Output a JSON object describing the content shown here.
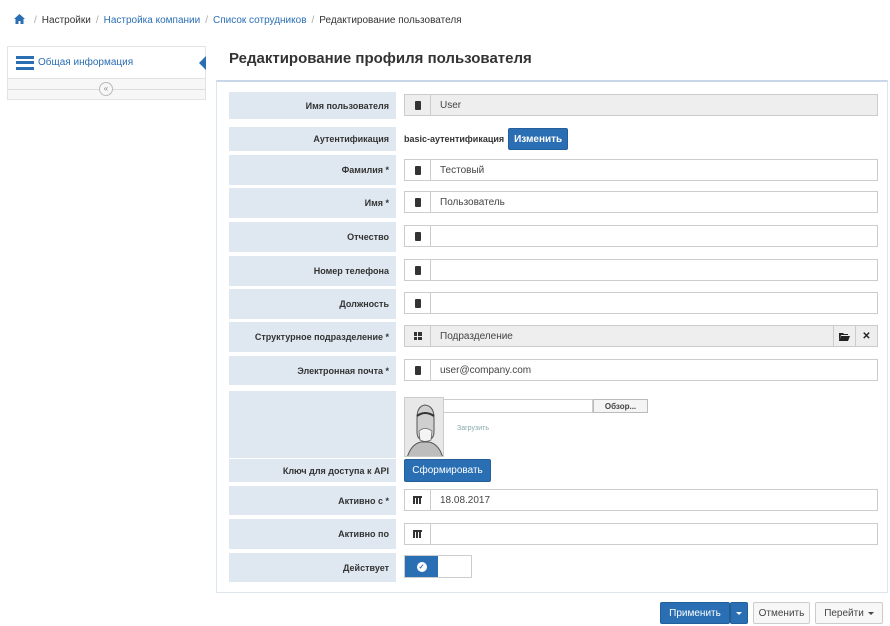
{
  "breadcrumb": {
    "items": [
      "Настройки",
      "Настройка компании",
      "Список сотрудников",
      "Редактирование пользователя"
    ]
  },
  "sidebar": {
    "item_label": "Общая информация",
    "collapse_glyph": "«"
  },
  "page": {
    "title": "Редактирование профиля пользователя"
  },
  "form": {
    "username": {
      "label": "Имя пользователя",
      "value": "User"
    },
    "auth": {
      "label": "Аутентификация",
      "value": "basic-аутентификация",
      "button": "Изменить"
    },
    "lastname": {
      "label": "Фамилия *",
      "value": "Тестовый"
    },
    "firstname": {
      "label": "Имя *",
      "value": "Пользователь"
    },
    "patronymic": {
      "label": "Отчество",
      "value": ""
    },
    "phone": {
      "label": "Номер телефона",
      "value": ""
    },
    "position": {
      "label": "Должность",
      "value": ""
    },
    "department": {
      "label": "Структурное подразделение *",
      "value": "Подразделение"
    },
    "email": {
      "label": "Электронная почта *",
      "value": "user@company.com"
    },
    "photo": {
      "browse": "Обзор...",
      "upload": "Загрузить"
    },
    "api_key": {
      "label": "Ключ для доступа к API",
      "button": "Сформировать"
    },
    "active_from": {
      "label": "Активно с *",
      "value": "18.08.2017"
    },
    "active_to": {
      "label": "Активно по",
      "value": ""
    },
    "active": {
      "label": "Действует",
      "checked": true
    }
  },
  "footer": {
    "apply": "Применить",
    "cancel": "Отменить",
    "goto": "Перейти"
  },
  "colors": {
    "primary": "#2a6fb3",
    "label_bg": "#dfe7f0"
  }
}
